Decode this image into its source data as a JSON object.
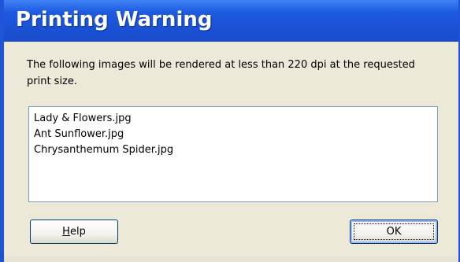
{
  "dialog": {
    "title": "Printing Warning",
    "message": "The following images will be rendered at less than 220 dpi at the requested print size.",
    "files": [
      "Lady & Flowers.jpg",
      "Ant Sunflower.jpg",
      "Chrysanthemum Spider.jpg"
    ],
    "buttons": {
      "help_accel": "H",
      "help_rest": "elp",
      "ok_label": "OK"
    }
  },
  "colors": {
    "title_bar": "#1f54d8",
    "dialog_face": "#ece9d8",
    "list_border": "#7f9db9",
    "button_border": "#003c74"
  }
}
